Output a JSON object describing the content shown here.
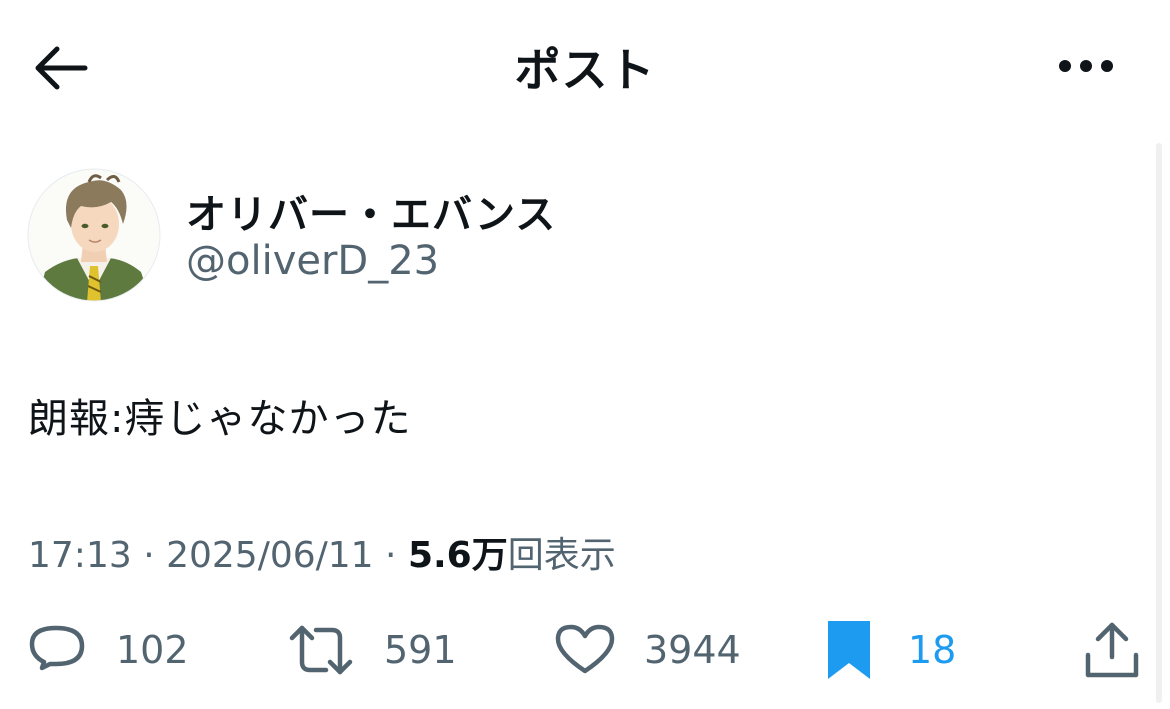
{
  "header": {
    "title": "ポスト"
  },
  "author": {
    "name": "オリバー・エバンス",
    "handle": "@oliverD_23"
  },
  "post": {
    "text": "朗報:痔じゃなかった"
  },
  "meta": {
    "time": "17:13",
    "date": "2025/06/11",
    "views_count": "5.6万",
    "views_label": "回表示"
  },
  "actions": {
    "replies": "102",
    "reposts": "591",
    "likes": "3944",
    "bookmarks": "18"
  },
  "colors": {
    "text": "#0f1419",
    "secondary": "#536471",
    "accent": "#1d9bf0"
  },
  "icons": {
    "back": "arrow-left-icon",
    "more": "more-horizontal-icon",
    "reply": "reply-icon",
    "repost": "repost-icon",
    "like": "heart-icon",
    "bookmark": "bookmark-icon",
    "share": "share-icon"
  }
}
